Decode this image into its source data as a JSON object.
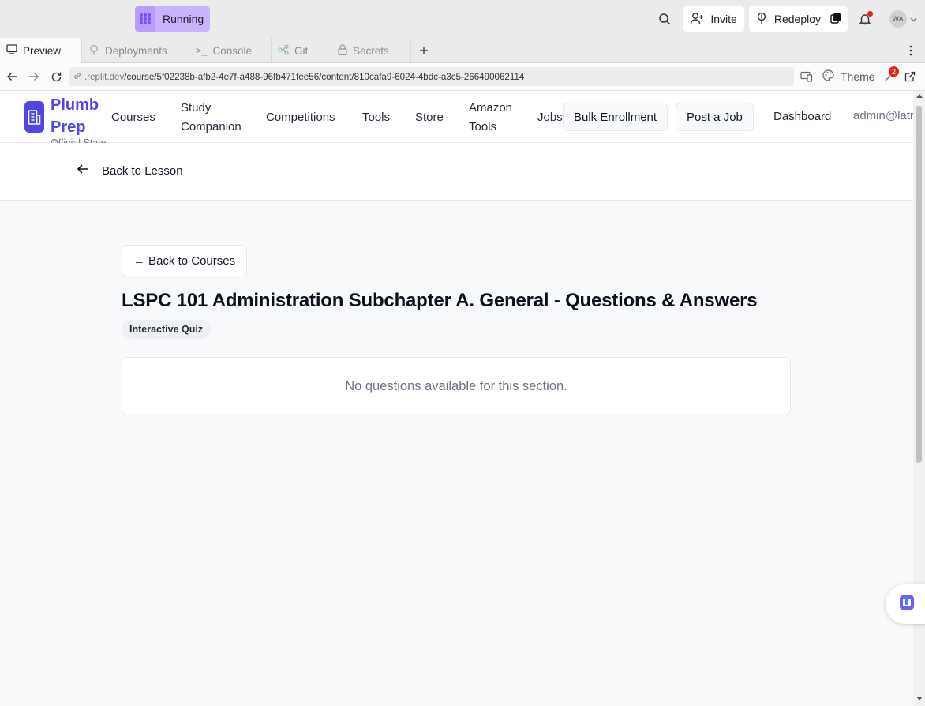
{
  "replit": {
    "status_label": "Running",
    "invite_label": "Invite",
    "redeploy_label": "Redeploy",
    "avatar_initials": "WA",
    "tabs": [
      {
        "label": "Preview",
        "icon": "monitor-icon"
      },
      {
        "label": "Deployments",
        "icon": "deploy-icon"
      },
      {
        "label": "Console",
        "icon": "terminal-icon"
      },
      {
        "label": "Git",
        "icon": "git-icon"
      },
      {
        "label": "Secrets",
        "icon": "lock-icon"
      }
    ],
    "url_host": ".replit.dev",
    "url_path": "/course/5f02238b-afb2-4e7f-a488-96fb471fee56/content/810cafa9-6024-4bdc-a3c5-266490062114",
    "theme_label": "Theme",
    "devtools_badge": "2",
    "accent": "#c9b3ff"
  },
  "app": {
    "brand": "Plumb Prep",
    "tagline": "Official State Prep Course",
    "nav": [
      "Courses",
      "Study Companion",
      "Competitions",
      "Tools",
      "Store",
      "Amazon Tools",
      "Jobs"
    ],
    "bulk_enrollment": "Bulk Enrollment",
    "post_job": "Post a Job",
    "dashboard": "Dashboard",
    "user": "admin@latr",
    "back_to_lesson": "Back to Lesson",
    "back_to_courses": "← Back to Courses",
    "title": "LSPC 101 Administration Subchapter A. General - Questions & Answers",
    "chip": "Interactive Quiz",
    "empty_message": "No questions available for this section.",
    "brand_color": "#4f46e5"
  }
}
